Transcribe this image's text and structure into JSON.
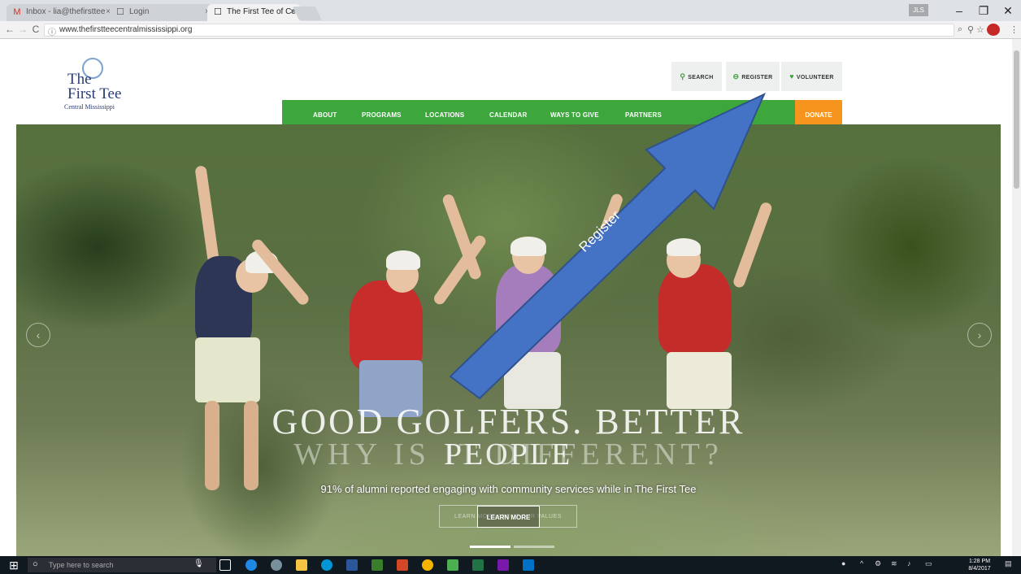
{
  "browser": {
    "tabs": [
      {
        "label": "Inbox - lia@thefirsttee",
        "favicon": "M",
        "close": "×"
      },
      {
        "label": "Login",
        "favicon": "☐",
        "close": "×"
      },
      {
        "label": "The First Tee of Central M",
        "favicon": "☐",
        "close": "×"
      }
    ],
    "profile_label": "JLS",
    "window_controls": {
      "minimize": "–",
      "restore": "❐",
      "close": "✕"
    },
    "url": "www.thefirstteecentralmississippi.org",
    "nav": {
      "back": "←",
      "forward": "→",
      "reload": "C",
      "info": "ⓘ"
    }
  },
  "site": {
    "logo": {
      "line1": "The",
      "line2": "First Tee",
      "line3": "Central Mississippi"
    },
    "utility": {
      "search": "SEARCH",
      "register": "REGISTER",
      "volunteer": "VOLUNTEER"
    },
    "nav": [
      "ABOUT",
      "PROGRAMS",
      "LOCATIONS",
      "CALENDAR",
      "WAYS TO GIVE",
      "PARTNERS"
    ],
    "donate": "DONATE",
    "hero": {
      "headline_top": "GOOD GOLFERS. BETTER",
      "headline_ghost": "WHY IS IT DIFFERENT?",
      "headline_bottom": "PEOPLE",
      "subtitle": "91% of alumni reported engaging with community services while in The First Tee",
      "ghost_button": "LEARN MORE ABOUT OUR VALUES",
      "button": "LEARN MORE",
      "prev": "‹",
      "next": "›"
    }
  },
  "annotation": {
    "label": "Register",
    "color": "#4472c4"
  },
  "taskbar": {
    "search_placeholder": "Type here to search",
    "time": "1:28 PM",
    "date": "8/4/2017"
  }
}
